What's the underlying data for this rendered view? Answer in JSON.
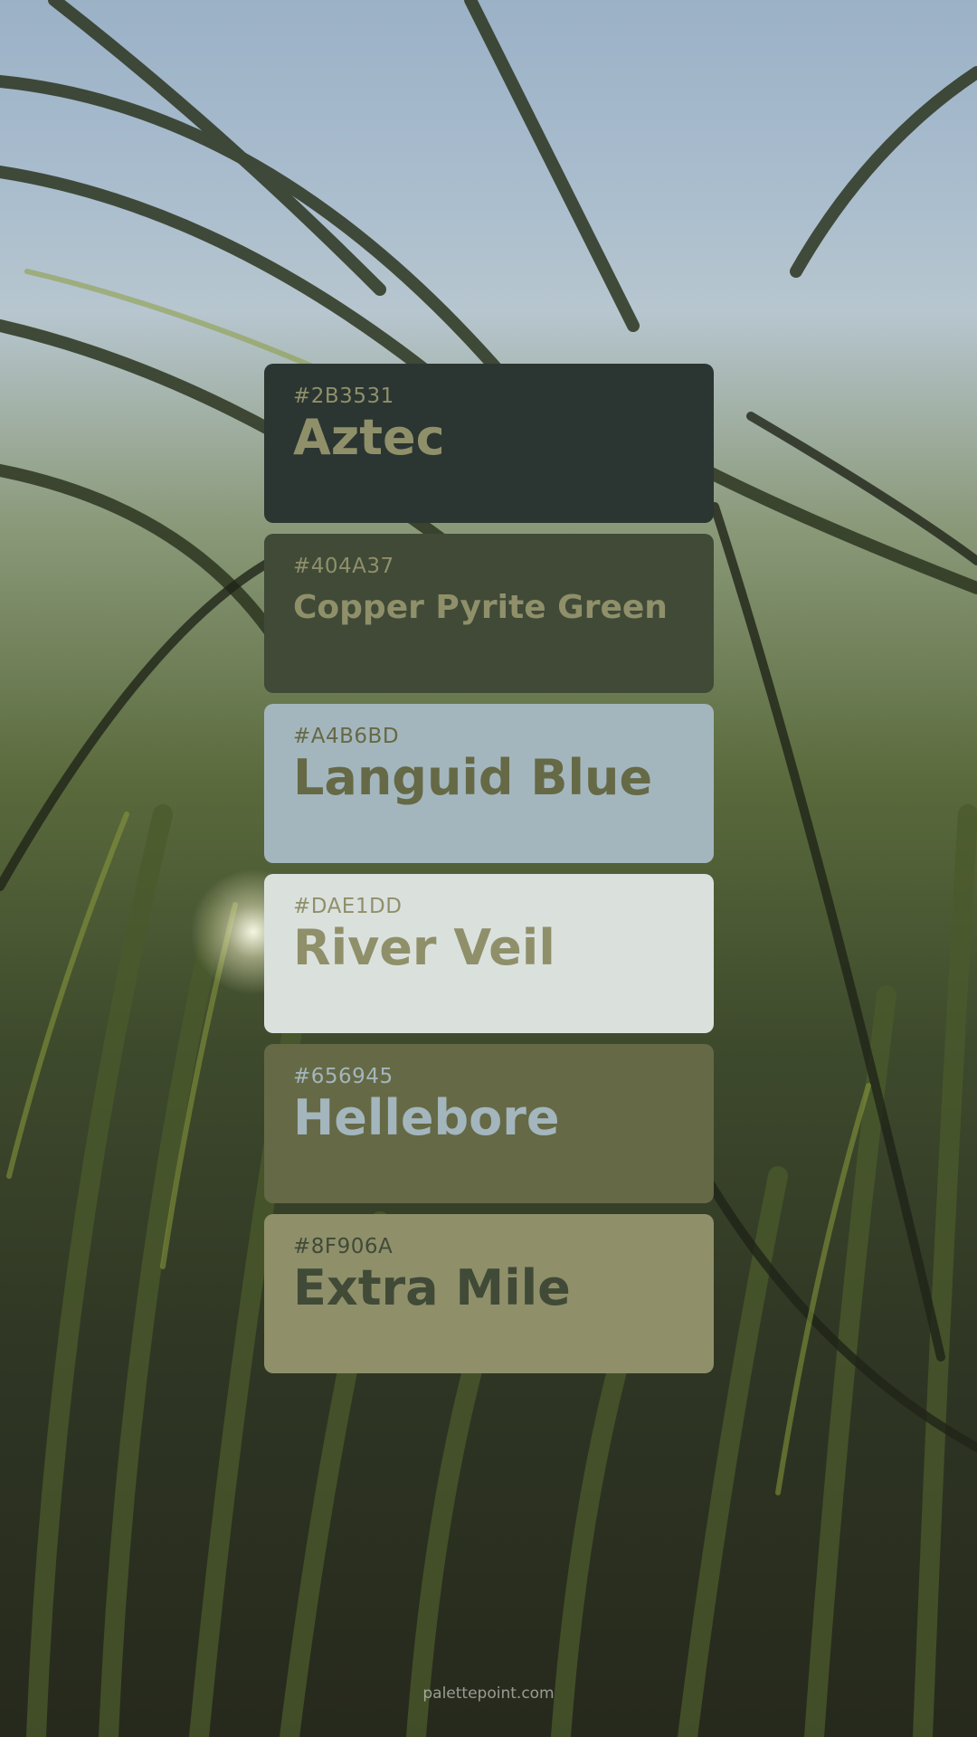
{
  "palette": [
    {
      "hex": "#2B3531",
      "name": "Aztec",
      "swatch_color": "#2B3531",
      "text_color": "#8F906A"
    },
    {
      "hex": "#404A37",
      "name": "Copper Pyrite Green",
      "swatch_color": "#404A37",
      "text_color": "#8F906A"
    },
    {
      "hex": "#A4B6BD",
      "name": "Languid Blue",
      "swatch_color": "#A4B6BD",
      "text_color": "#656945"
    },
    {
      "hex": "#DAE1DD",
      "name": "River Veil",
      "swatch_color": "#DAE1DD",
      "text_color": "#8F906A"
    },
    {
      "hex": "#656945",
      "name": "Hellebore",
      "swatch_color": "#656945",
      "text_color": "#A4B6BD"
    },
    {
      "hex": "#8F906A",
      "name": "Extra Mile",
      "swatch_color": "#8F906A",
      "text_color": "#404A37"
    }
  ],
  "footer": {
    "text": "palettepoint.com"
  }
}
